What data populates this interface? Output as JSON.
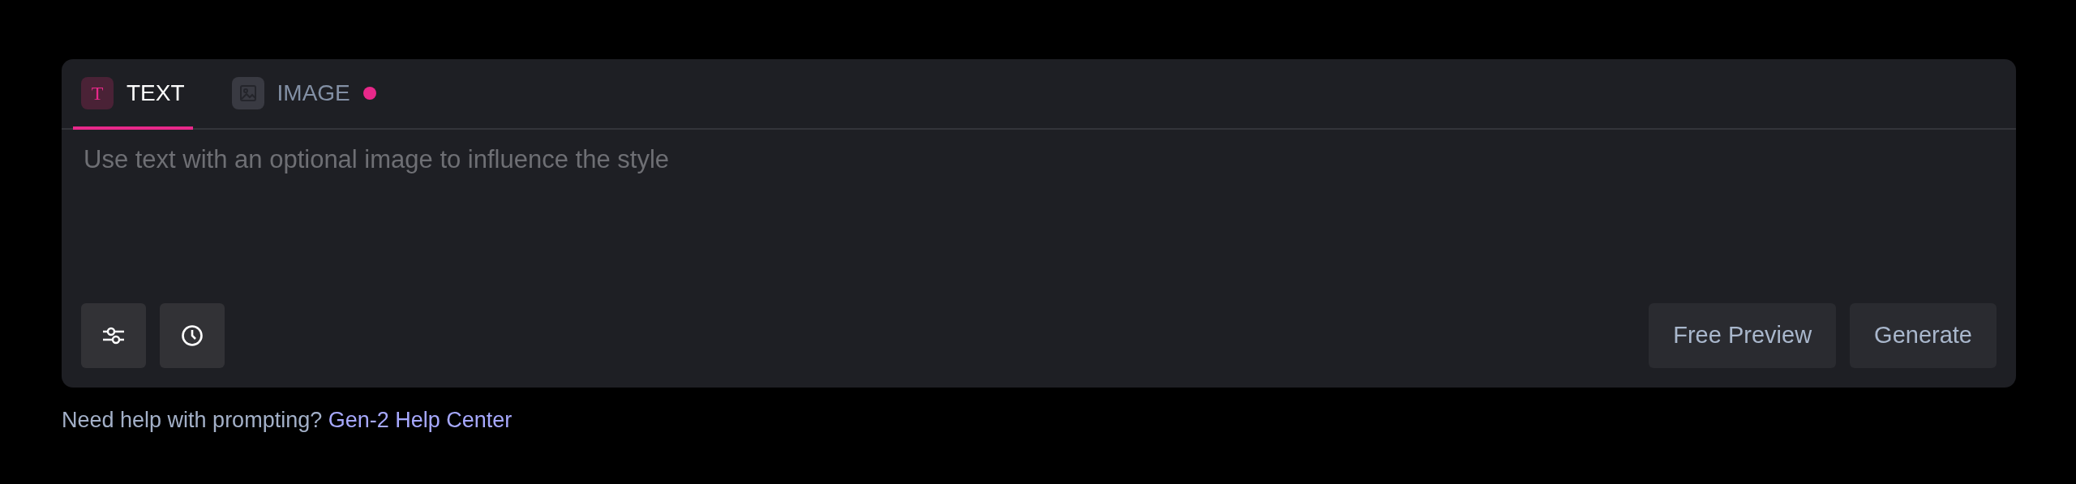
{
  "tabs": [
    {
      "label": "TEXT",
      "kind": "text",
      "glyph": "T",
      "selected": true,
      "notification": false
    },
    {
      "label": "IMAGE",
      "kind": "image",
      "selected": false,
      "notification": true
    }
  ],
  "prompt": {
    "placeholder": "Use text with an optional image to influence the style"
  },
  "tool_buttons": [
    {
      "kind": "settings"
    },
    {
      "kind": "history"
    }
  ],
  "action_buttons": [
    "Free Preview",
    "Generate"
  ],
  "help": {
    "text": "Need help with prompting?",
    "link": "Gen-2 Help Center"
  }
}
